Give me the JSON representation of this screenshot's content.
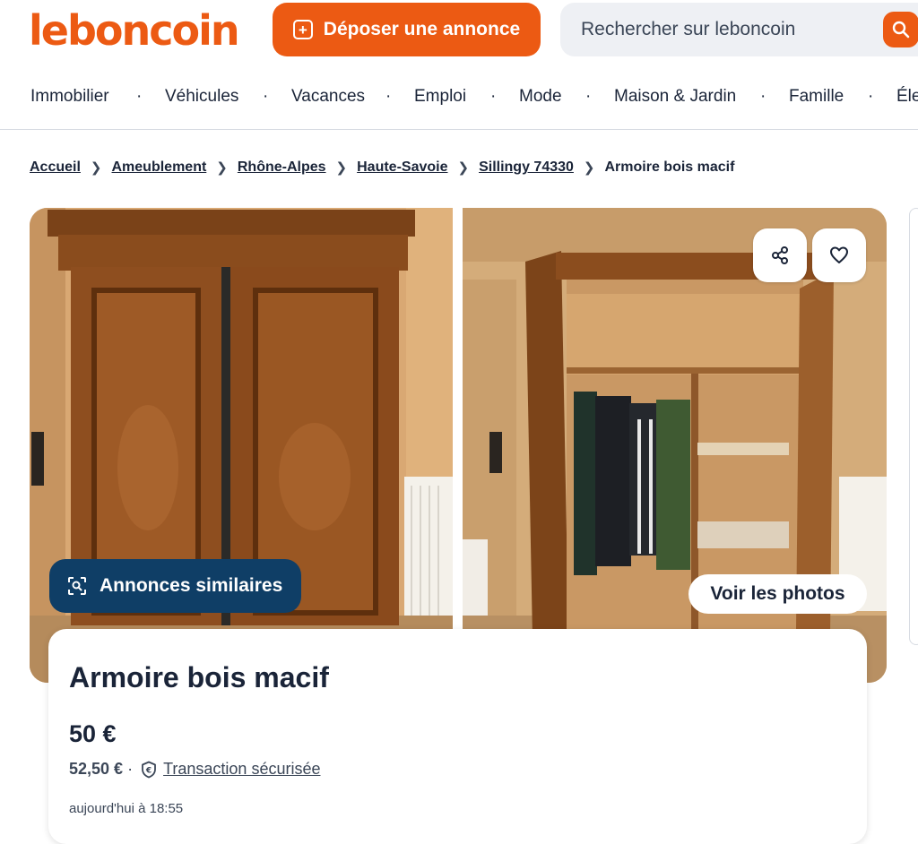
{
  "header": {
    "logo_text": "leboncoin",
    "post_label": "Déposer une annonce",
    "search_placeholder": "Rechercher sur leboncoin",
    "brand_color": "#ec5a13"
  },
  "nav": {
    "items": [
      "Immobilier",
      "Véhicules",
      "Vacances",
      "Emploi",
      "Mode",
      "Maison & Jardin",
      "Famille",
      "Éle"
    ],
    "separator": "·"
  },
  "breadcrumb": {
    "items": [
      "Accueil",
      "Ameublement",
      "Rhône-Alpes",
      "Haute-Savoie",
      "Sillingy 74330"
    ],
    "current": "Armoire bois macif"
  },
  "gallery": {
    "similar_label": "Annonces similaires",
    "see_photos_label": "Voir les photos",
    "share_icon": "share-icon",
    "favorite_icon": "heart-icon"
  },
  "listing": {
    "title": "Armoire bois macif",
    "price": "50 €",
    "price_with_fees": "52,50 €",
    "secure_label": "Transaction sécurisée",
    "posted": "aujourd'hui à 18:55"
  }
}
